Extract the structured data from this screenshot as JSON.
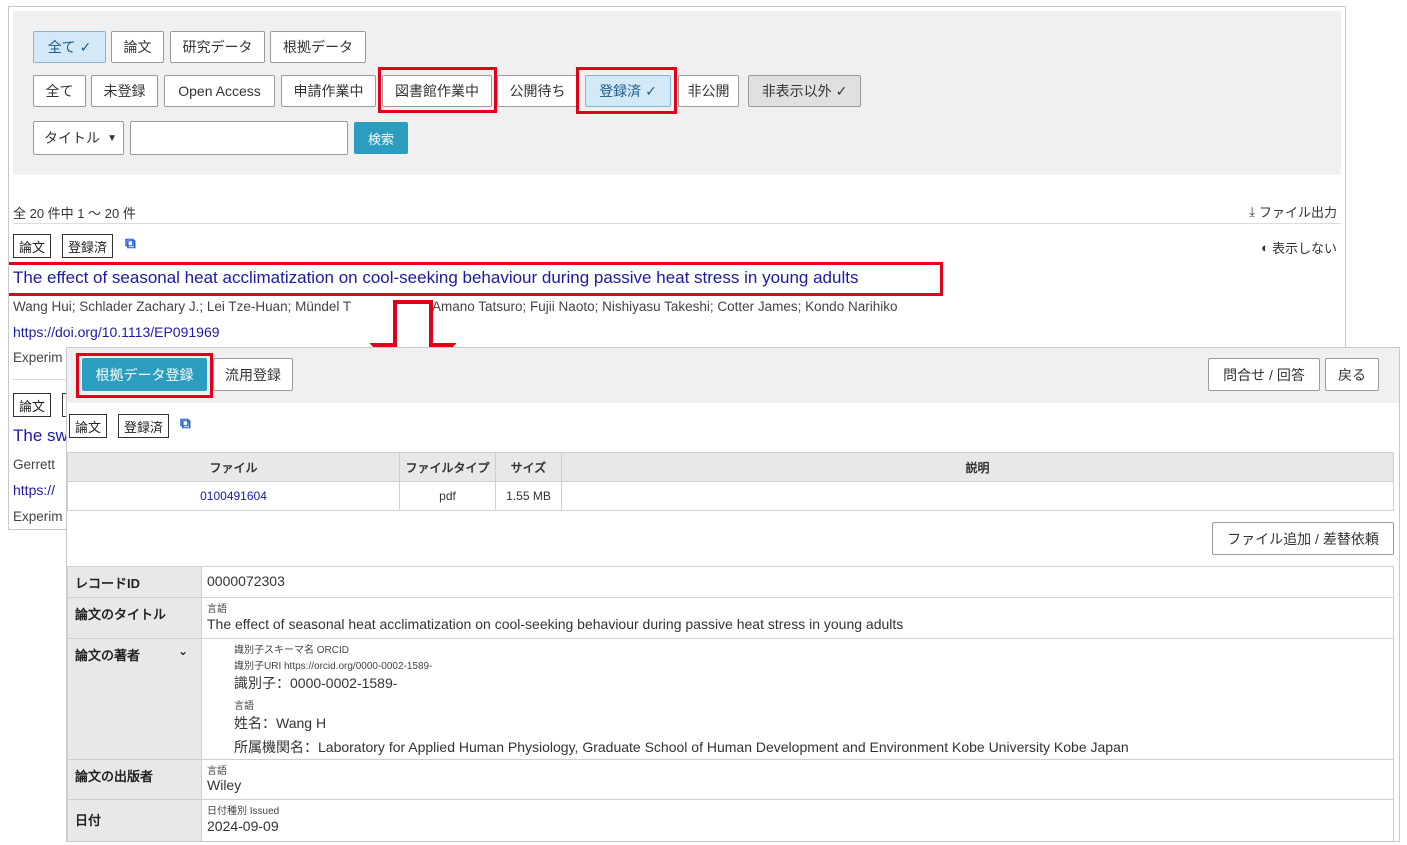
{
  "filters": {
    "type_buttons": [
      {
        "label": "全て",
        "check": "✓"
      },
      {
        "label": "論文"
      },
      {
        "label": "研究データ"
      },
      {
        "label": "根拠データ"
      }
    ],
    "status_buttons": [
      {
        "label": "全て"
      },
      {
        "label": "未登録"
      },
      {
        "label": "Open Access"
      },
      {
        "label": "申請作業中"
      },
      {
        "label": "図書館作業中"
      },
      {
        "label": "公開待ち"
      },
      {
        "label": "登録済",
        "check": "✓"
      },
      {
        "label": "非公開"
      },
      {
        "label": "非表示以外",
        "check": "✓"
      }
    ],
    "search_field": "タイトル",
    "search_value": "",
    "search_button": "検索"
  },
  "results": {
    "count_text": "全 20 件中 1 ～ 20 件",
    "export_label": "ファイル出力",
    "hide_label": "表示しない",
    "items": [
      {
        "type_tag": "論文",
        "status_tag": "登録済",
        "title": "The effect of seasonal heat acclimatization on cool-seeking behaviour during passive heat stress in young adults",
        "authors": "Wang Hui; Schlader Zachary J.; Lei Tze-Huan; Mündel T",
        "authors_rest": "Amano Tatsuro; Fujii Naoto; Nishiyasu Takeshi; Cotter James; Kondo Narihiko",
        "doi": "https://doi.org/10.1113/EP091969",
        "journal": "Experim"
      },
      {
        "type_tag": "論文",
        "title": "The sw",
        "authors": "Gerrett",
        "doi": "https://",
        "journal": "Experim"
      }
    ]
  },
  "detail": {
    "toolbar": {
      "evidence_register": "根拠データ登録",
      "reuse_register": "流用登録",
      "inquiry": "問合せ / 回答",
      "back": "戻る"
    },
    "type_tag": "論文",
    "status_tag": "登録済",
    "files_table": {
      "headers": [
        "ファイル",
        "ファイルタイプ",
        "サイズ",
        "説明"
      ],
      "rows": [
        {
          "file": "0100491604",
          "type": "pdf",
          "size": "1.55 MB",
          "description": ""
        }
      ]
    },
    "file_add_button": "ファイル追加 / 差替依頼",
    "record_id_label": "レコードID",
    "record_id": "0000072303",
    "title_label": "論文のタイトル",
    "title_lang": "言語",
    "title_value": "The effect of seasonal heat acclimatization on cool-seeking behaviour during passive heat stress in young adults",
    "author_label": "論文の著者",
    "author": {
      "scheme_line": "識別子スキーマ名  ORCID",
      "uri_line": "識別子URI  https://orcid.org/0000-0002-1589-",
      "id_line": "識別子：0000-0002-1589-",
      "lang": "言語",
      "name_line": "姓名：Wang H",
      "affiliation_line": "所属機関名：Laboratory for Applied Human Physiology, Graduate School of Human Development and Environment Kobe University Kobe Japan"
    },
    "publisher_label": "論文の出版者",
    "publisher_lang": "言語",
    "publisher": "Wiley",
    "date_label": "日付",
    "date_type_line": "日付種別  Issued",
    "date": "2024-09-09"
  }
}
